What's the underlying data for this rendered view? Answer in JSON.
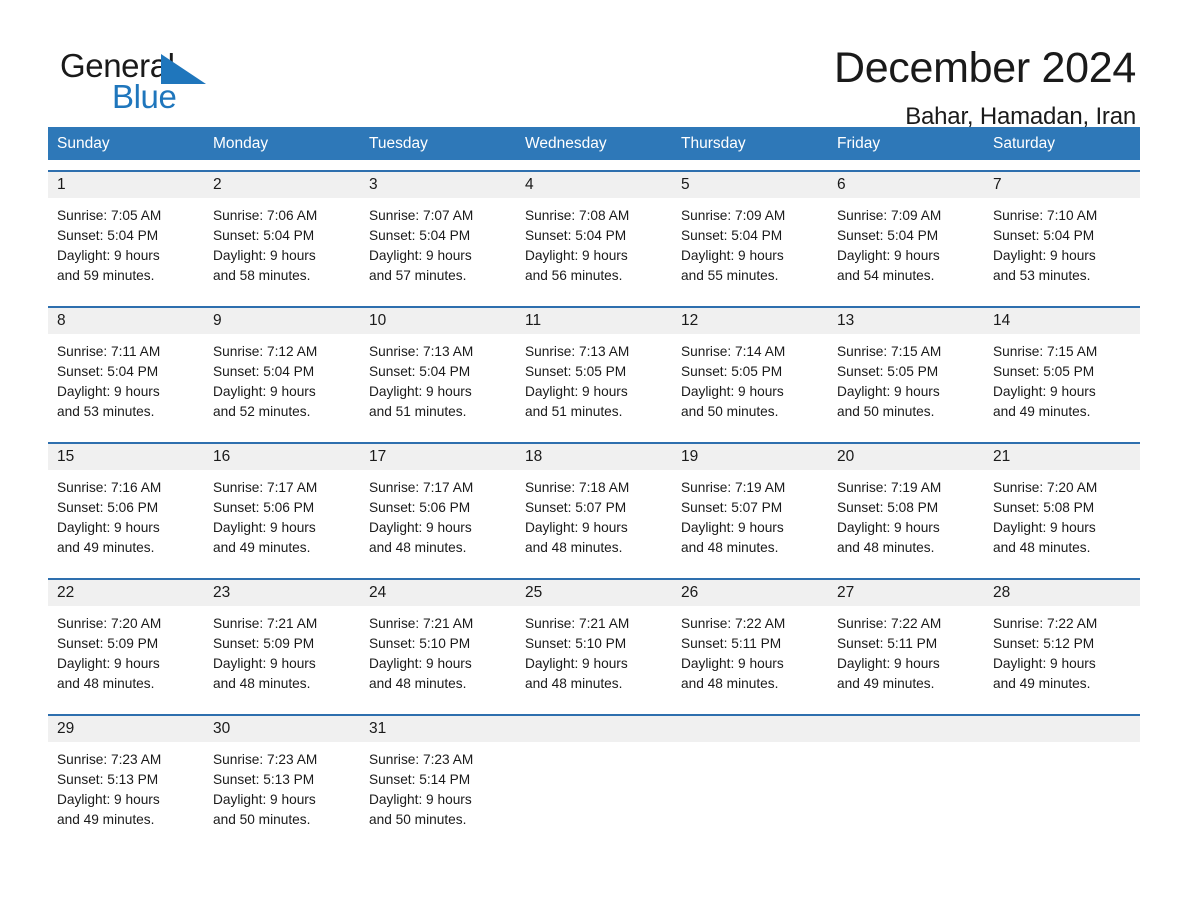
{
  "logo": {
    "word_one": "General",
    "word_two": "Blue",
    "triangle_icon": "triangle-icon",
    "brand_color": "#1f76bc"
  },
  "header": {
    "title": "December 2024",
    "location": "Bahar, Hamadan, Iran"
  },
  "theme": {
    "header_band": "#2e78b8",
    "row_rule": "#2e6fae",
    "daynum_band": "#f0f0f0",
    "text": "#1a1a1a"
  },
  "weekdays": [
    "Sunday",
    "Monday",
    "Tuesday",
    "Wednesday",
    "Thursday",
    "Friday",
    "Saturday"
  ],
  "weeks": [
    [
      {
        "day": "1",
        "sunrise": "Sunrise: 7:05 AM",
        "sunset": "Sunset: 5:04 PM",
        "daylight_line1": "Daylight: 9 hours",
        "daylight_line2": "and 59 minutes."
      },
      {
        "day": "2",
        "sunrise": "Sunrise: 7:06 AM",
        "sunset": "Sunset: 5:04 PM",
        "daylight_line1": "Daylight: 9 hours",
        "daylight_line2": "and 58 minutes."
      },
      {
        "day": "3",
        "sunrise": "Sunrise: 7:07 AM",
        "sunset": "Sunset: 5:04 PM",
        "daylight_line1": "Daylight: 9 hours",
        "daylight_line2": "and 57 minutes."
      },
      {
        "day": "4",
        "sunrise": "Sunrise: 7:08 AM",
        "sunset": "Sunset: 5:04 PM",
        "daylight_line1": "Daylight: 9 hours",
        "daylight_line2": "and 56 minutes."
      },
      {
        "day": "5",
        "sunrise": "Sunrise: 7:09 AM",
        "sunset": "Sunset: 5:04 PM",
        "daylight_line1": "Daylight: 9 hours",
        "daylight_line2": "and 55 minutes."
      },
      {
        "day": "6",
        "sunrise": "Sunrise: 7:09 AM",
        "sunset": "Sunset: 5:04 PM",
        "daylight_line1": "Daylight: 9 hours",
        "daylight_line2": "and 54 minutes."
      },
      {
        "day": "7",
        "sunrise": "Sunrise: 7:10 AM",
        "sunset": "Sunset: 5:04 PM",
        "daylight_line1": "Daylight: 9 hours",
        "daylight_line2": "and 53 minutes."
      }
    ],
    [
      {
        "day": "8",
        "sunrise": "Sunrise: 7:11 AM",
        "sunset": "Sunset: 5:04 PM",
        "daylight_line1": "Daylight: 9 hours",
        "daylight_line2": "and 53 minutes."
      },
      {
        "day": "9",
        "sunrise": "Sunrise: 7:12 AM",
        "sunset": "Sunset: 5:04 PM",
        "daylight_line1": "Daylight: 9 hours",
        "daylight_line2": "and 52 minutes."
      },
      {
        "day": "10",
        "sunrise": "Sunrise: 7:13 AM",
        "sunset": "Sunset: 5:04 PM",
        "daylight_line1": "Daylight: 9 hours",
        "daylight_line2": "and 51 minutes."
      },
      {
        "day": "11",
        "sunrise": "Sunrise: 7:13 AM",
        "sunset": "Sunset: 5:05 PM",
        "daylight_line1": "Daylight: 9 hours",
        "daylight_line2": "and 51 minutes."
      },
      {
        "day": "12",
        "sunrise": "Sunrise: 7:14 AM",
        "sunset": "Sunset: 5:05 PM",
        "daylight_line1": "Daylight: 9 hours",
        "daylight_line2": "and 50 minutes."
      },
      {
        "day": "13",
        "sunrise": "Sunrise: 7:15 AM",
        "sunset": "Sunset: 5:05 PM",
        "daylight_line1": "Daylight: 9 hours",
        "daylight_line2": "and 50 minutes."
      },
      {
        "day": "14",
        "sunrise": "Sunrise: 7:15 AM",
        "sunset": "Sunset: 5:05 PM",
        "daylight_line1": "Daylight: 9 hours",
        "daylight_line2": "and 49 minutes."
      }
    ],
    [
      {
        "day": "15",
        "sunrise": "Sunrise: 7:16 AM",
        "sunset": "Sunset: 5:06 PM",
        "daylight_line1": "Daylight: 9 hours",
        "daylight_line2": "and 49 minutes."
      },
      {
        "day": "16",
        "sunrise": "Sunrise: 7:17 AM",
        "sunset": "Sunset: 5:06 PM",
        "daylight_line1": "Daylight: 9 hours",
        "daylight_line2": "and 49 minutes."
      },
      {
        "day": "17",
        "sunrise": "Sunrise: 7:17 AM",
        "sunset": "Sunset: 5:06 PM",
        "daylight_line1": "Daylight: 9 hours",
        "daylight_line2": "and 48 minutes."
      },
      {
        "day": "18",
        "sunrise": "Sunrise: 7:18 AM",
        "sunset": "Sunset: 5:07 PM",
        "daylight_line1": "Daylight: 9 hours",
        "daylight_line2": "and 48 minutes."
      },
      {
        "day": "19",
        "sunrise": "Sunrise: 7:19 AM",
        "sunset": "Sunset: 5:07 PM",
        "daylight_line1": "Daylight: 9 hours",
        "daylight_line2": "and 48 minutes."
      },
      {
        "day": "20",
        "sunrise": "Sunrise: 7:19 AM",
        "sunset": "Sunset: 5:08 PM",
        "daylight_line1": "Daylight: 9 hours",
        "daylight_line2": "and 48 minutes."
      },
      {
        "day": "21",
        "sunrise": "Sunrise: 7:20 AM",
        "sunset": "Sunset: 5:08 PM",
        "daylight_line1": "Daylight: 9 hours",
        "daylight_line2": "and 48 minutes."
      }
    ],
    [
      {
        "day": "22",
        "sunrise": "Sunrise: 7:20 AM",
        "sunset": "Sunset: 5:09 PM",
        "daylight_line1": "Daylight: 9 hours",
        "daylight_line2": "and 48 minutes."
      },
      {
        "day": "23",
        "sunrise": "Sunrise: 7:21 AM",
        "sunset": "Sunset: 5:09 PM",
        "daylight_line1": "Daylight: 9 hours",
        "daylight_line2": "and 48 minutes."
      },
      {
        "day": "24",
        "sunrise": "Sunrise: 7:21 AM",
        "sunset": "Sunset: 5:10 PM",
        "daylight_line1": "Daylight: 9 hours",
        "daylight_line2": "and 48 minutes."
      },
      {
        "day": "25",
        "sunrise": "Sunrise: 7:21 AM",
        "sunset": "Sunset: 5:10 PM",
        "daylight_line1": "Daylight: 9 hours",
        "daylight_line2": "and 48 minutes."
      },
      {
        "day": "26",
        "sunrise": "Sunrise: 7:22 AM",
        "sunset": "Sunset: 5:11 PM",
        "daylight_line1": "Daylight: 9 hours",
        "daylight_line2": "and 48 minutes."
      },
      {
        "day": "27",
        "sunrise": "Sunrise: 7:22 AM",
        "sunset": "Sunset: 5:11 PM",
        "daylight_line1": "Daylight: 9 hours",
        "daylight_line2": "and 49 minutes."
      },
      {
        "day": "28",
        "sunrise": "Sunrise: 7:22 AM",
        "sunset": "Sunset: 5:12 PM",
        "daylight_line1": "Daylight: 9 hours",
        "daylight_line2": "and 49 minutes."
      }
    ],
    [
      {
        "day": "29",
        "sunrise": "Sunrise: 7:23 AM",
        "sunset": "Sunset: 5:13 PM",
        "daylight_line1": "Daylight: 9 hours",
        "daylight_line2": "and 49 minutes."
      },
      {
        "day": "30",
        "sunrise": "Sunrise: 7:23 AM",
        "sunset": "Sunset: 5:13 PM",
        "daylight_line1": "Daylight: 9 hours",
        "daylight_line2": "and 50 minutes."
      },
      {
        "day": "31",
        "sunrise": "Sunrise: 7:23 AM",
        "sunset": "Sunset: 5:14 PM",
        "daylight_line1": "Daylight: 9 hours",
        "daylight_line2": "and 50 minutes."
      },
      {
        "day": "",
        "sunrise": "",
        "sunset": "",
        "daylight_line1": "",
        "daylight_line2": ""
      },
      {
        "day": "",
        "sunrise": "",
        "sunset": "",
        "daylight_line1": "",
        "daylight_line2": ""
      },
      {
        "day": "",
        "sunrise": "",
        "sunset": "",
        "daylight_line1": "",
        "daylight_line2": ""
      },
      {
        "day": "",
        "sunrise": "",
        "sunset": "",
        "daylight_line1": "",
        "daylight_line2": ""
      }
    ]
  ]
}
